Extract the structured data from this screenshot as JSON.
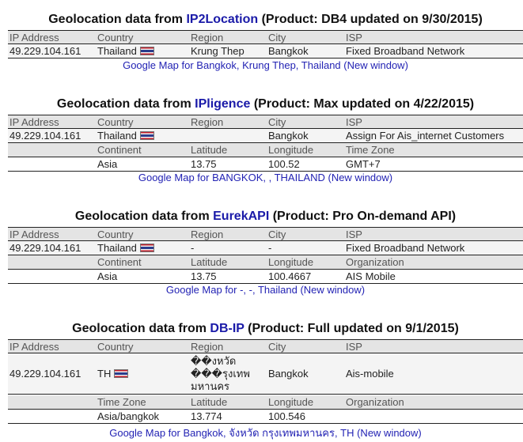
{
  "sections": [
    {
      "title_prefix": "Geolocation data from ",
      "source": "IP2Location",
      "title_suffix": " (Product: DB4 updated on 9/30/2015)",
      "headers": [
        "IP Address",
        "Country",
        "Region",
        "City",
        "ISP"
      ],
      "values": [
        "49.229.104.161",
        "Thailand",
        "Krung Thep",
        "Bangkok",
        "Fixed Broadband Network"
      ],
      "map_link": "Google Map for Bangkok, Krung Thep, Thailand (New window)"
    },
    {
      "title_prefix": "Geolocation data from ",
      "source": "IPligence",
      "title_suffix": " (Product: Max updated on 4/22/2015)",
      "headers": [
        "IP Address",
        "Country",
        "Region",
        "City",
        "ISP"
      ],
      "values": [
        "49.229.104.161",
        "Thailand",
        "",
        "Bangkok",
        "Assign For Ais_internet Customers"
      ],
      "headers2": [
        "",
        "Continent",
        "Latitude",
        "Longitude",
        "Time Zone"
      ],
      "values2": [
        "",
        "Asia",
        "13.75",
        "100.52",
        "GMT+7"
      ],
      "map_link": "Google Map for BANGKOK, , THAILAND (New window)"
    },
    {
      "title_prefix": "Geolocation data from ",
      "source": "EurekAPI",
      "title_suffix": " (Product: Pro On-demand API)",
      "headers": [
        "IP Address",
        "Country",
        "Region",
        "City",
        "ISP"
      ],
      "values": [
        "49.229.104.161",
        "Thailand",
        "-",
        "-",
        "Fixed Broadband Network"
      ],
      "headers2": [
        "",
        "Continent",
        "Latitude",
        "Longitude",
        "Organization"
      ],
      "values2": [
        "",
        "Asia",
        "13.75",
        "100.4667",
        "AIS Mobile"
      ],
      "map_link": "Google Map for -, -, Thailand (New window)"
    },
    {
      "title_prefix": "Geolocation data from ",
      "source": "DB-IP",
      "title_suffix": " (Product: Full updated on 9/1/2015)",
      "headers": [
        "IP Address",
        "Country",
        "Region",
        "City",
        "ISP"
      ],
      "values": [
        "49.229.104.161",
        "TH",
        "��งหวัด ���รุงเทพ มหานคร",
        "Bangkok",
        "Ais-mobile"
      ],
      "headers2": [
        "",
        "Time Zone",
        "Latitude",
        "Longitude",
        "Organization"
      ],
      "values2": [
        "",
        "Asia/bangkok",
        "13.774",
        "100.546",
        ""
      ],
      "map_link": "Google Map for Bangkok, จังหวัด กรุงเทพมหานคร, TH (New window)"
    }
  ]
}
